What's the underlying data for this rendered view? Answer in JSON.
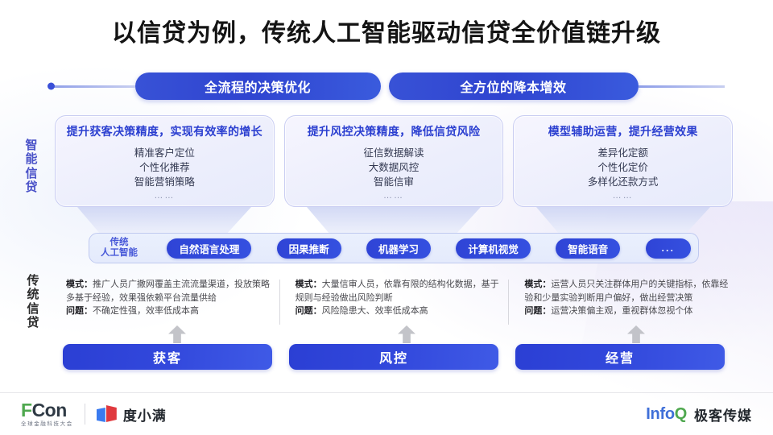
{
  "title": "以信贷为例，传统人工智能驱动信贷全价值链升级",
  "banner": {
    "pill_left": "全流程的决策优化",
    "pill_right": "全方位的降本增效"
  },
  "side_labels": {
    "smart": [
      "智",
      "能",
      "信",
      "贷"
    ],
    "traditional": [
      "传",
      "统",
      "信",
      "贷"
    ]
  },
  "smart_cards": [
    {
      "title": "提升获客决策精度，实现有效率的增长",
      "items": [
        "精准客户定位",
        "个性化推荐",
        "智能营销策略"
      ],
      "more": "……"
    },
    {
      "title": "提升风控决策精度，降低信贷风险",
      "items": [
        "征信数据解读",
        "大数据风控",
        "智能信审"
      ],
      "more": "……"
    },
    {
      "title": "模型辅助运营，提升经营效果",
      "items": [
        "差异化定额",
        "个性化定价",
        "多样化还款方式"
      ],
      "more": "……"
    }
  ],
  "ai_bar": {
    "label": [
      "传统",
      "人工智能"
    ],
    "pills": [
      "自然语言处理",
      "因果推断",
      "机器学习",
      "计算机视觉",
      "智能语音"
    ],
    "more_pill": "..."
  },
  "traditional_columns": [
    {
      "mode_label": "模式：",
      "mode_text": "推广人员广撒网覆盖主流流量渠道，投放策略多基于经验，效果强依赖平台流量供给",
      "issue_label": "问题：",
      "issue_text": "不确定性强，效率低成本高"
    },
    {
      "mode_label": "模式：",
      "mode_text": "大量信审人员，依靠有限的结构化数据，基于规则与经验做出风险判断",
      "issue_label": "问题：",
      "issue_text": "风险隐患大、效率低成本高"
    },
    {
      "mode_label": "模式：",
      "mode_text": "运营人员只关注群体用户的关键指标，依靠经验和少量实验判断用户偏好，做出经营决策",
      "issue_label": "问题：",
      "issue_text": "运营决策偏主观，重视群体忽视个体"
    }
  ],
  "stages": [
    "获客",
    "风控",
    "经营"
  ],
  "footer": {
    "fcon_f": "F",
    "fcon_con": "Con",
    "fcon_sub": "全球金融科技大会",
    "duxiaoman": "度小满",
    "infoq_info": "Info",
    "infoq_q": "Q",
    "geek_media": "极客传媒"
  },
  "colors": {
    "brand_blue": "#2f44d6",
    "card_title_blue": "#2b3fd0",
    "smart_label_blue": "#4a52c8",
    "fcon_green": "#4fa84f",
    "infoq_blue": "#3f6fd8",
    "duxiaoman_blue": "#3a7bf0",
    "duxiaoman_red": "#e0393e"
  }
}
